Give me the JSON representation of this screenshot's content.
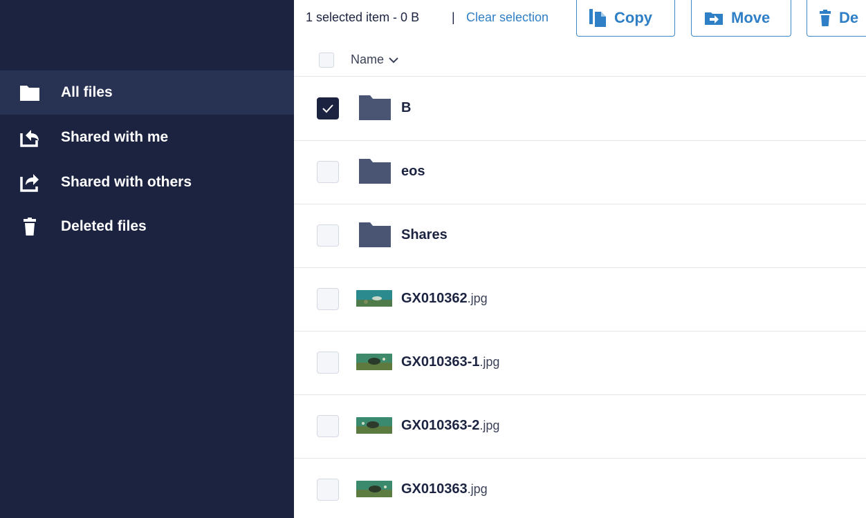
{
  "sidebar": {
    "items": [
      {
        "label": "All files",
        "icon": "folder-icon",
        "active": true
      },
      {
        "label": "Shared with me",
        "icon": "shared-with-me-icon",
        "active": false
      },
      {
        "label": "Shared with others",
        "icon": "shared-with-others-icon",
        "active": false
      },
      {
        "label": "Deleted files",
        "icon": "trash-icon",
        "active": false
      }
    ]
  },
  "toolbar": {
    "selection_text": "1 selected item - 0 B",
    "separator": "|",
    "clear_label": "Clear selection",
    "copy_label": "Copy",
    "move_label": "Move",
    "delete_label": "De"
  },
  "list": {
    "header": {
      "name_label": "Name",
      "sort_icon": "chevron-down-icon"
    },
    "rows": [
      {
        "name": "B",
        "ext": "",
        "type": "folder",
        "checked": true
      },
      {
        "name": "eos",
        "ext": "",
        "type": "folder",
        "checked": false
      },
      {
        "name": "Shares",
        "ext": "",
        "type": "folder",
        "checked": false
      },
      {
        "name": "GX010362",
        "ext": ".jpg",
        "type": "image",
        "checked": false
      },
      {
        "name": "GX010363-1",
        "ext": ".jpg",
        "type": "image",
        "checked": false
      },
      {
        "name": "GX010363-2",
        "ext": ".jpg",
        "type": "image",
        "checked": false
      },
      {
        "name": "GX010363",
        "ext": ".jpg",
        "type": "image",
        "checked": false
      }
    ]
  },
  "colors": {
    "sidebar_bg": "#1b2340",
    "sidebar_active_bg": "#283253",
    "accent": "#2f7fc7",
    "folder": "#4a5573"
  }
}
